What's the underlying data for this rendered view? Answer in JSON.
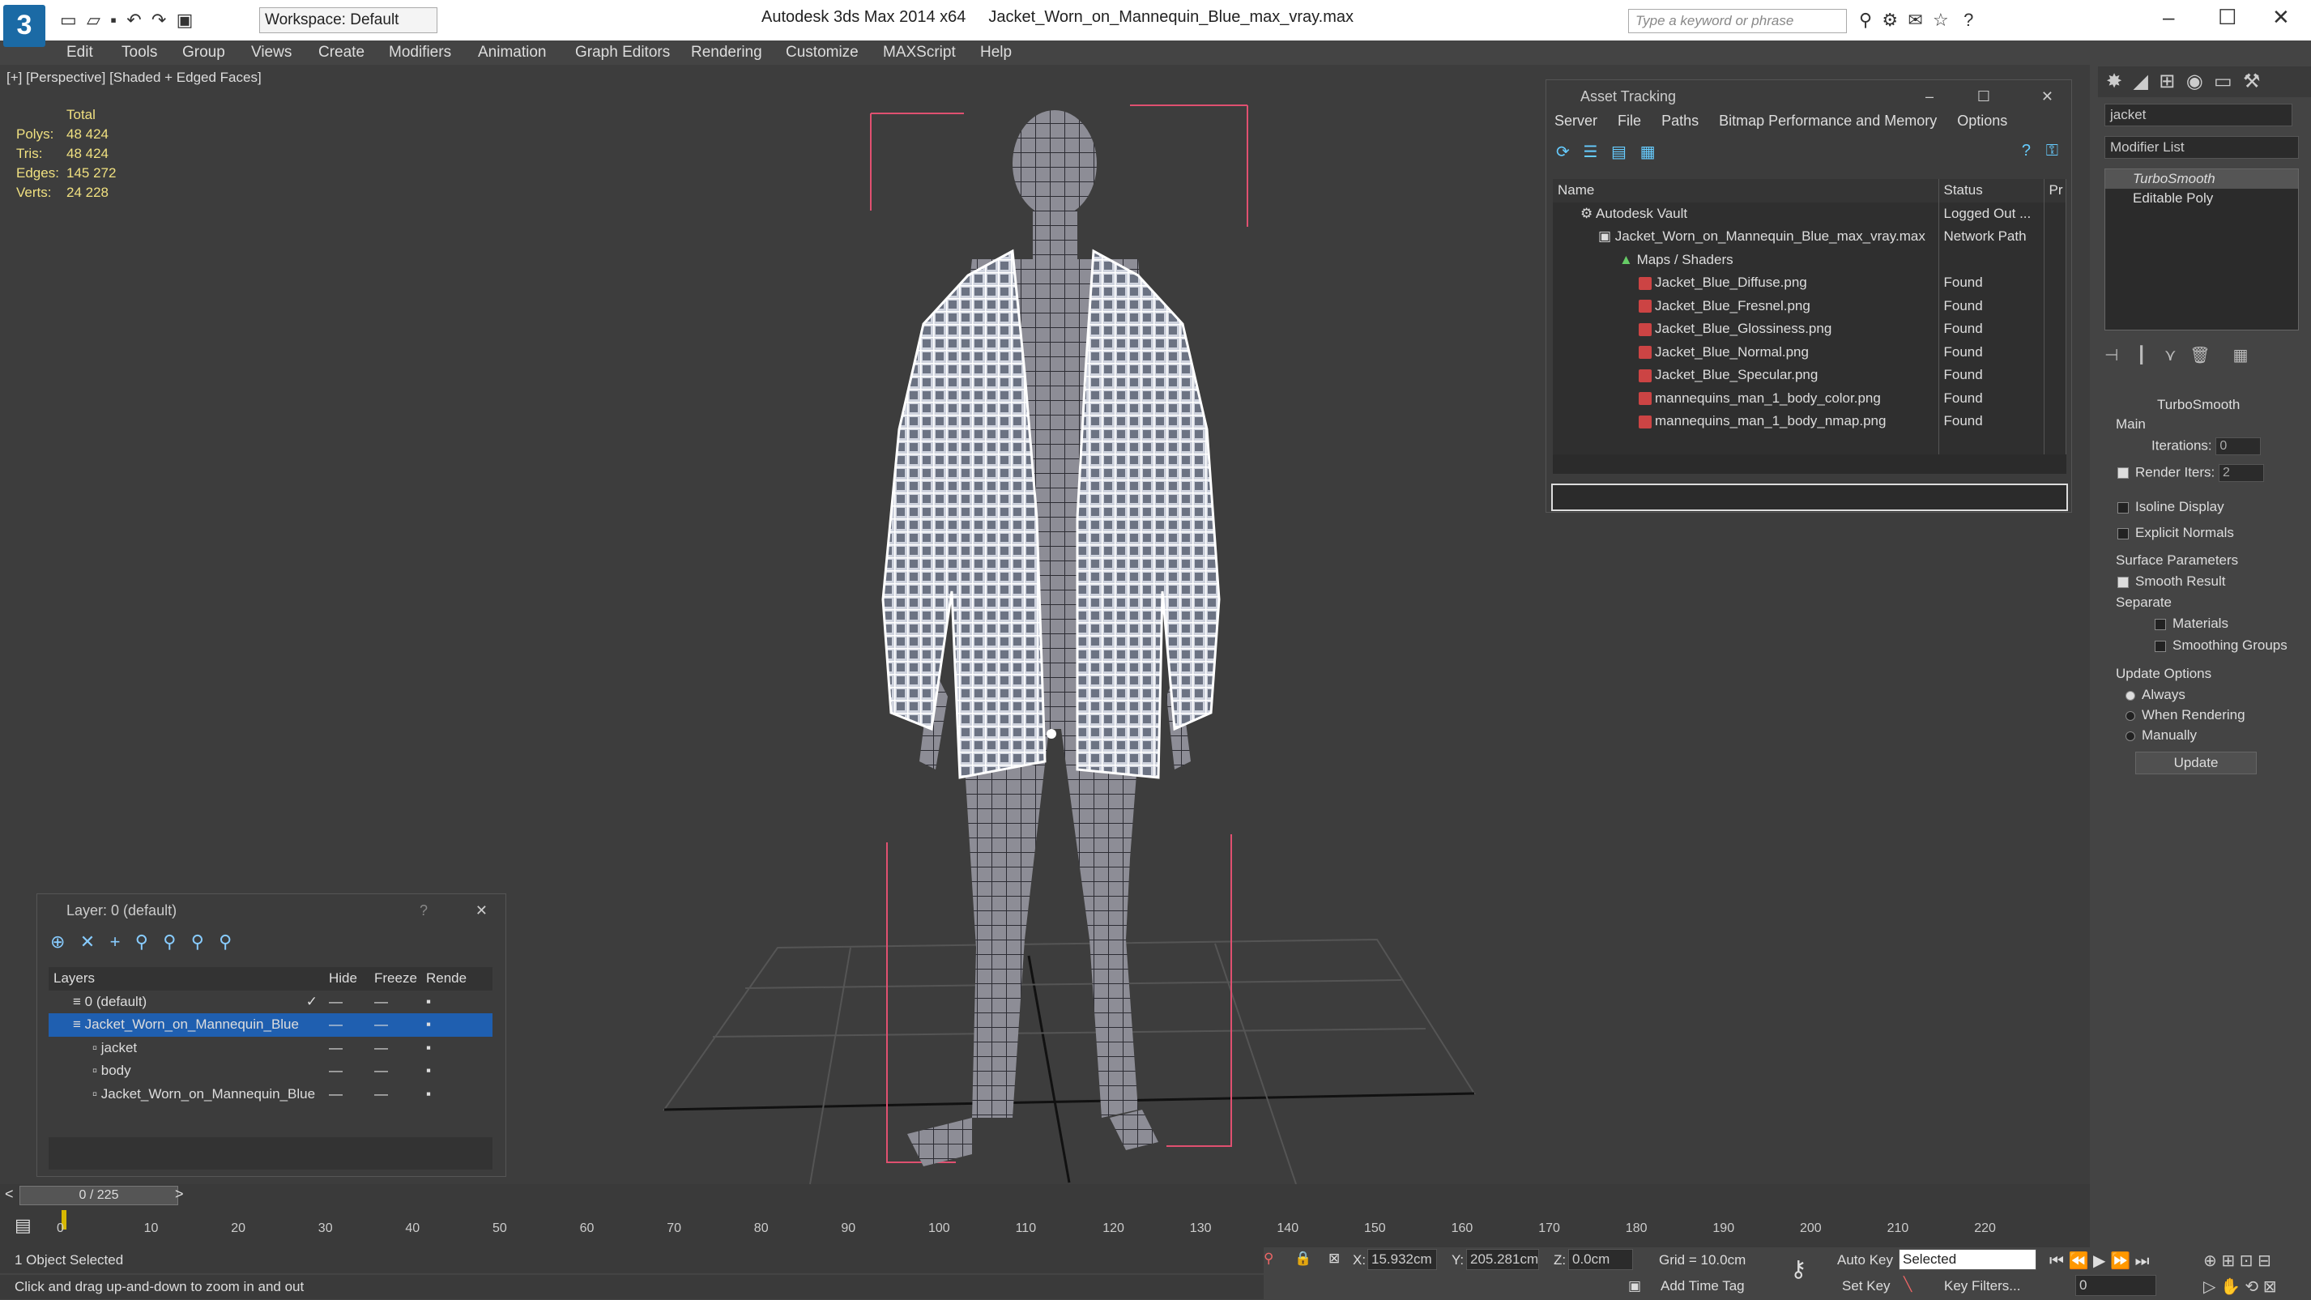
{
  "titlebar": {
    "app": "Autodesk 3ds Max  2014 x64",
    "file": "Jacket_Worn_on_Mannequin_Blue_max_vray.max",
    "workspace": "Workspace: Default",
    "search_placeholder": "Type a keyword or phrase"
  },
  "menu": [
    "Edit",
    "Tools",
    "Group",
    "Views",
    "Create",
    "Modifiers",
    "Animation",
    "Graph Editors",
    "Rendering",
    "Customize",
    "MAXScript",
    "Help"
  ],
  "viewport": {
    "label": "[+] [Perspective] [Shaded + Edged Faces]",
    "stats_header": "Total",
    "stats": [
      {
        "k": "Polys:",
        "v": "48 424"
      },
      {
        "k": "Tris:",
        "v": "48 424"
      },
      {
        "k": "Edges:",
        "v": "145 272"
      },
      {
        "k": "Verts:",
        "v": "24 228"
      }
    ]
  },
  "asset_tracking": {
    "title": "Asset Tracking",
    "menu": [
      "Server",
      "File",
      "Paths",
      "Bitmap Performance and Memory",
      "Options"
    ],
    "columns": [
      "Name",
      "Status",
      "Pr"
    ],
    "rows": [
      {
        "name": "Autodesk Vault",
        "status": "Logged Out ..."
      },
      {
        "name": "Jacket_Worn_on_Mannequin_Blue_max_vray.max",
        "status": "Network Path"
      },
      {
        "name": "Maps / Shaders",
        "status": ""
      },
      {
        "name": "Jacket_Blue_Diffuse.png",
        "status": "Found"
      },
      {
        "name": "Jacket_Blue_Fresnel.png",
        "status": "Found"
      },
      {
        "name": "Jacket_Blue_Glossiness.png",
        "status": "Found"
      },
      {
        "name": "Jacket_Blue_Normal.png",
        "status": "Found"
      },
      {
        "name": "Jacket_Blue_Specular.png",
        "status": "Found"
      },
      {
        "name": "mannequins_man_1_body_color.png",
        "status": "Found"
      },
      {
        "name": "mannequins_man_1_body_nmap.png",
        "status": "Found"
      }
    ]
  },
  "layer": {
    "title": "Layer: 0 (default)",
    "help": "?",
    "columns": [
      "Layers",
      "Hide",
      "Freeze",
      "Rende"
    ],
    "rows": [
      "0 (default)",
      "Jacket_Worn_on_Mannequin_Blue",
      "jacket",
      "body",
      "Jacket_Worn_on_Mannequin_Blue"
    ]
  },
  "command": {
    "name": "jacket",
    "modifier_list": "Modifier List",
    "stack": [
      "TurboSmooth",
      "Editable Poly"
    ],
    "rollout": "TurboSmooth",
    "main": "Main",
    "iterations_label": "Iterations:",
    "iterations": "0",
    "render_iters_label": "Render Iters:",
    "render_iters": "2",
    "isoline": "Isoline Display",
    "explicit": "Explicit Normals",
    "surface": "Surface Parameters",
    "smooth": "Smooth Result",
    "separate": "Separate",
    "materials": "Materials",
    "smoothing": "Smoothing Groups",
    "update_opts": "Update Options",
    "always": "Always",
    "when_rendering": "When Rendering",
    "manually": "Manually",
    "update": "Update"
  },
  "timeline": {
    "frame": "0 / 225",
    "ticks": [
      "0",
      "10",
      "20",
      "30",
      "40",
      "50",
      "60",
      "70",
      "80",
      "90",
      "100",
      "110",
      "120",
      "130",
      "140",
      "150",
      "160",
      "170",
      "180",
      "190",
      "200",
      "210",
      "220"
    ]
  },
  "status": {
    "selected": "1 Object Selected",
    "hint": "Click and drag up-and-down to zoom in and out",
    "x_label": "X:",
    "x": "15.932cm",
    "y_label": "Y:",
    "y": "205.281cm",
    "z_label": "Z:",
    "z": "0.0cm",
    "grid": "Grid = 10.0cm",
    "add_time_tag": "Add Time Tag",
    "auto_key": "Auto Key",
    "set_key": "Set Key",
    "selected_dd": "Selected",
    "key_filters": "Key Filters...",
    "frame_field": "0"
  }
}
